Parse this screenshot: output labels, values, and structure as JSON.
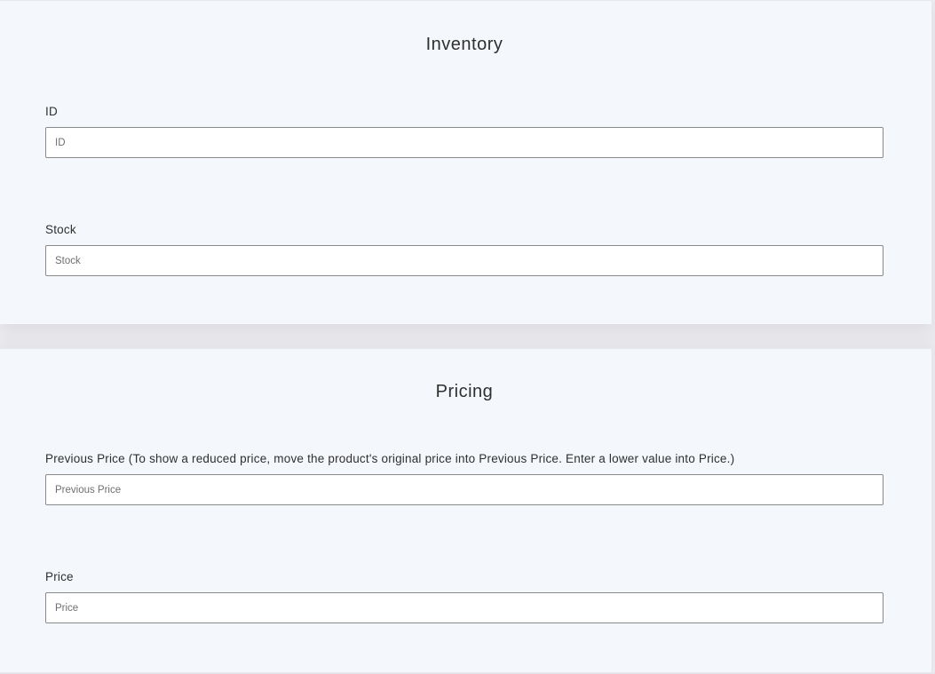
{
  "inventory": {
    "title": "Inventory",
    "id_field": {
      "label": "ID",
      "placeholder": "ID",
      "value": ""
    },
    "stock_field": {
      "label": "Stock",
      "placeholder": "Stock",
      "value": ""
    }
  },
  "pricing": {
    "title": "Pricing",
    "previous_price_field": {
      "label": "Previous Price (To show a reduced price, move the product's original price into Previous Price. Enter a lower value into Price.)",
      "placeholder": "Previous Price",
      "value": ""
    },
    "price_field": {
      "label": "Price",
      "placeholder": "Price",
      "value": ""
    }
  }
}
